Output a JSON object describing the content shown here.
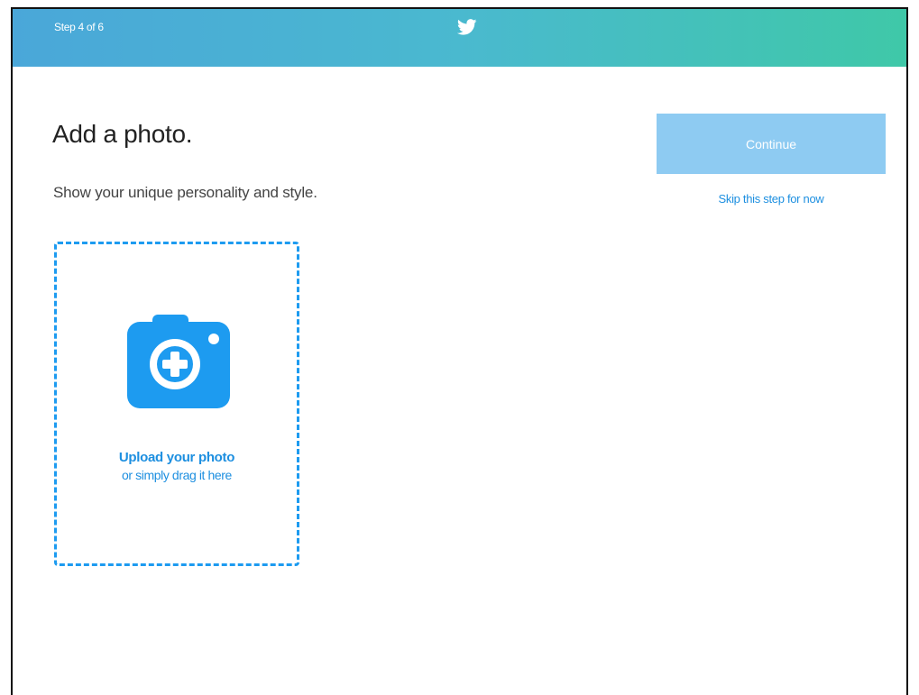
{
  "header": {
    "step_label": "Step 4 of 6",
    "logo_icon": "twitter-bird-icon",
    "gradient_start": "#4aa7d9",
    "gradient_end": "#3fc8a8"
  },
  "main": {
    "title": "Add a photo.",
    "subtitle": "Show your unique personality and style."
  },
  "actions": {
    "continue_label": "Continue",
    "skip_label": "Skip this step for now",
    "continue_color": "#8ecbf2",
    "link_color": "#1d8fe0"
  },
  "upload": {
    "icon": "camera-add-icon",
    "title": "Upload your photo",
    "subtitle": "or simply drag it here",
    "accent_color": "#1d9bf0"
  }
}
